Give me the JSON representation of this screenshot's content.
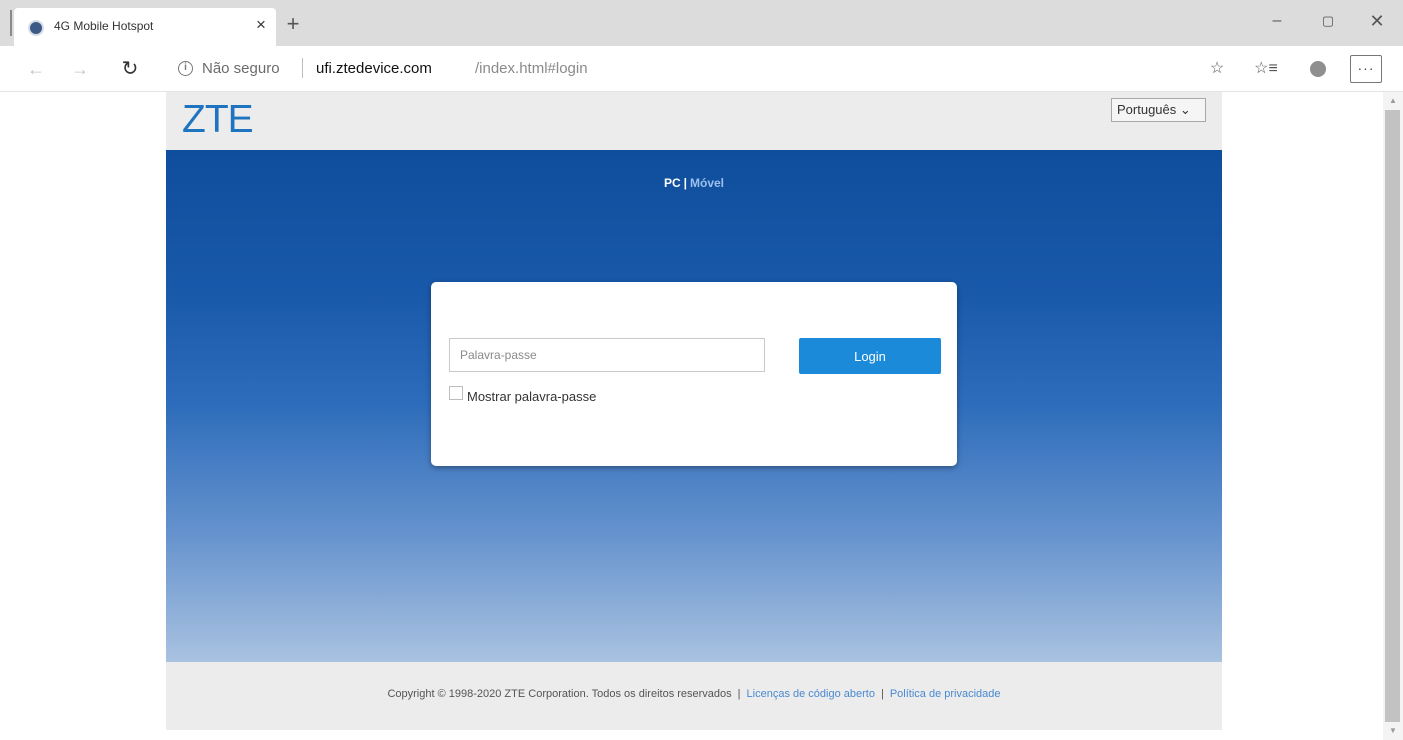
{
  "browser": {
    "tab_title": "4G Mobile Hotspot",
    "tab_close": "×",
    "new_tab": "+",
    "minimize": "–",
    "maximize": "▢",
    "close": "✕",
    "back": "←",
    "forward": "→",
    "reload": "↻",
    "security_label": "Não seguro",
    "url_host": "ufi.ztedevice.com",
    "url_path": "/index.html#login",
    "favorite_star": "☆",
    "favorites_list": "☆≡",
    "more": "···"
  },
  "header": {
    "logo": "ZTE",
    "language": "Português ⌄"
  },
  "hero": {
    "mode_pc": "PC",
    "mode_separator": "|",
    "mode_mobile": "Móvel"
  },
  "login": {
    "password_placeholder": "Palavra-passe",
    "password_value": "",
    "login_button": "Login",
    "show_password_label": "Mostrar palavra-passe",
    "show_password_checked": false
  },
  "footer": {
    "copyright": "Copyright © 1998-2020 ZTE Corporation. Todos os direitos reservados",
    "separator": "|",
    "open_source_link": "Licenças de código aberto",
    "privacy_link": "Política de privacidade"
  },
  "colors": {
    "brand_blue": "#1f74c0",
    "login_button": "#1a8ad9",
    "hero_top": "#0f4e9c",
    "hero_bottom": "#a9c2e0",
    "footer_link": "#4a89d0"
  }
}
